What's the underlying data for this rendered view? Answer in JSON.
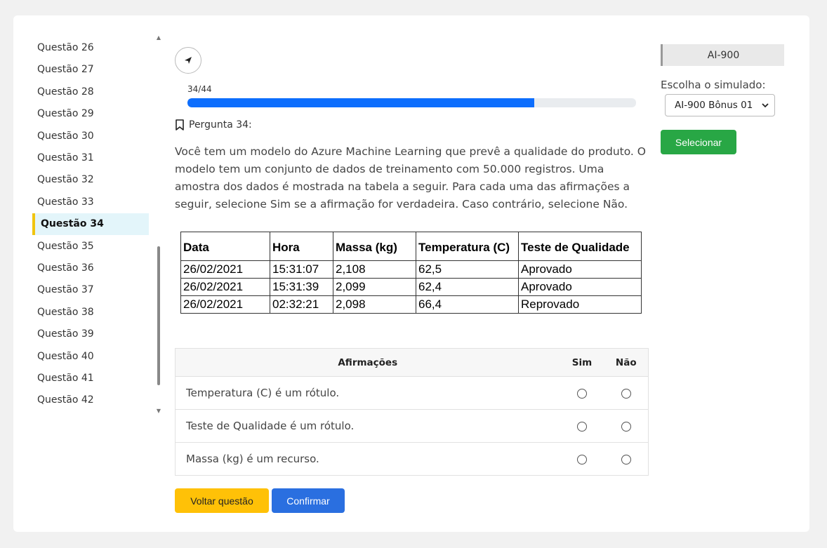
{
  "sidebar": {
    "items": [
      {
        "label": "Questão 26"
      },
      {
        "label": "Questão 27"
      },
      {
        "label": "Questão 28"
      },
      {
        "label": "Questão 29"
      },
      {
        "label": "Questão 30"
      },
      {
        "label": "Questão 31"
      },
      {
        "label": "Questão 32"
      },
      {
        "label": "Questão 33"
      },
      {
        "label": "Questão 34",
        "active": true
      },
      {
        "label": "Questão 35"
      },
      {
        "label": "Questão 36"
      },
      {
        "label": "Questão 37"
      },
      {
        "label": "Questão 38"
      },
      {
        "label": "Questão 39"
      },
      {
        "label": "Questão 40"
      },
      {
        "label": "Questão 41"
      },
      {
        "label": "Questão 42"
      }
    ]
  },
  "progress": {
    "label": "34/44",
    "current": 34,
    "total": 44
  },
  "question": {
    "heading": "Pergunta 34:",
    "text": "Você tem um modelo do Azure Machine Learning que prevê a qualidade do produto. O modelo tem um conjunto de dados de treinamento com 50.000 registros. Uma amostra dos dados é mostrada na tabela a seguir. Para cada uma das afirmações a seguir, selecione Sim se a afirmação for verdadeira. Caso contrário, selecione Não."
  },
  "data_table": {
    "headers": [
      "Data",
      "Hora",
      "Massa (kg)",
      "Temperatura (C)",
      "Teste de Qualidade"
    ],
    "rows": [
      [
        "26/02/2021",
        "15:31:07",
        "2,108",
        "62,5",
        "Aprovado"
      ],
      [
        "26/02/2021",
        "15:31:39",
        "2,099",
        "62,4",
        "Aprovado"
      ],
      [
        "26/02/2021",
        "02:32:21",
        "2,098",
        "66,4",
        "Reprovado"
      ]
    ]
  },
  "affirmations": {
    "header": "Afirmações",
    "yes_label": "Sim",
    "no_label": "Não",
    "items": [
      "Temperatura (C) é um rótulo.",
      "Teste de Qualidade é um rótulo.",
      "Massa (kg) é um recurso."
    ]
  },
  "buttons": {
    "back_question": "Voltar questão",
    "confirm": "Confirmar",
    "select": "Selecionar"
  },
  "right_panel": {
    "exam": "AI-900",
    "sim_label": "Escolha o simulado:",
    "sim_selected": "AI-900 Bônus 01"
  },
  "colors": {
    "accent": "#0d6efd",
    "active_marker": "#f1c40f",
    "confirm": "#2a6fe0",
    "back": "#ffc107",
    "select": "#28a745"
  },
  "icons": [
    "back-arrow-icon",
    "bookmark-icon",
    "chevron-down-icon",
    "scroll-up-icon",
    "scroll-down-icon"
  ]
}
